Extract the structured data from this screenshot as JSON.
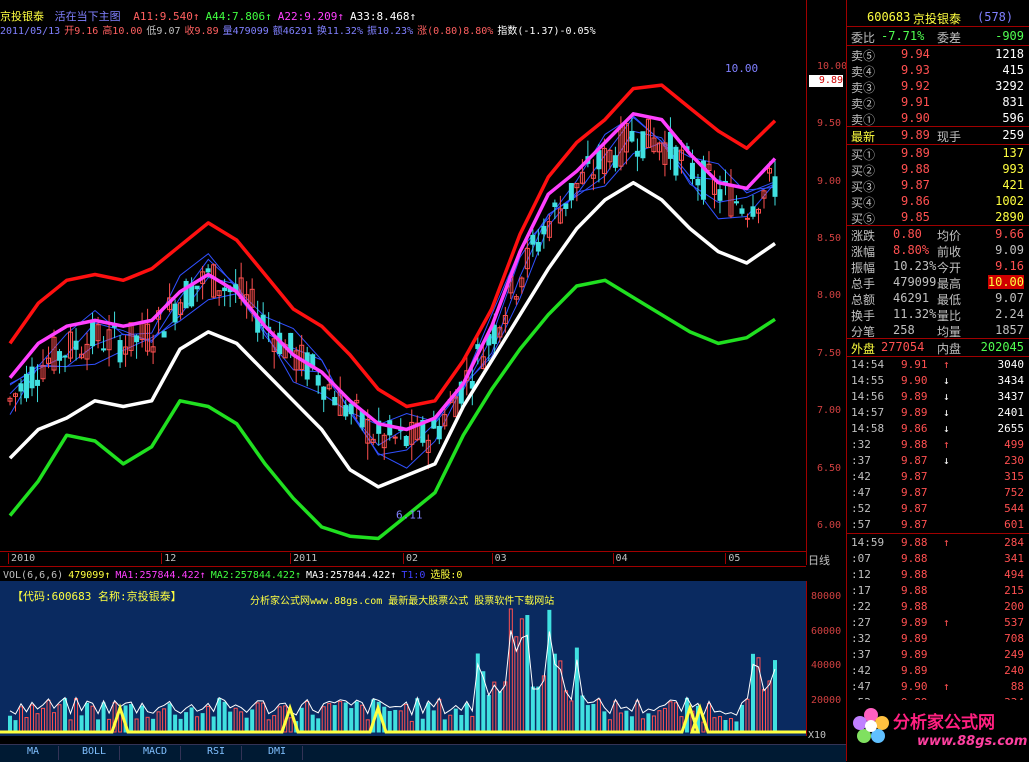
{
  "header": {
    "name": "京投银泰",
    "mode": "活在当下主图",
    "indicators": [
      {
        "text": "A11:9.540↑",
        "color": "#ff6060"
      },
      {
        "text": "A44:7.806↑",
        "color": "#40ff40"
      },
      {
        "text": "A22:9.209↑",
        "color": "#ff40ff"
      },
      {
        "text": "A33:8.468↑",
        "color": "#ffffff"
      }
    ],
    "info": [
      {
        "text": "2011/05/13",
        "color": "#8080ff"
      },
      {
        "text": "开9.16",
        "color": "#ff6060"
      },
      {
        "text": "高10.00",
        "color": "#ff6060"
      },
      {
        "text": "低9.07",
        "color": "#c0c0c0"
      },
      {
        "text": "收9.89",
        "color": "#ff6060"
      },
      {
        "text": "量479099",
        "color": "#8080ff"
      },
      {
        "text": "额46291",
        "color": "#8080ff"
      },
      {
        "text": "换11.32%",
        "color": "#8080ff"
      },
      {
        "text": "振10.23%",
        "color": "#8080ff"
      },
      {
        "text": "涨(0.80)8.80%",
        "color": "#ff6060"
      },
      {
        "text": "指数(-1.37)-0.05%",
        "color": "#ffffff"
      }
    ]
  },
  "price_axis": [
    "10.00",
    "9.50",
    "9.00",
    "8.50",
    "8.00",
    "7.50",
    "7.00",
    "6.50",
    "6.00"
  ],
  "current_price_tag": "9.89",
  "high_label": "10.00",
  "low_label": "6.11",
  "date_axis": [
    "2010",
    "12",
    "2011",
    "02",
    "03",
    "04",
    "05"
  ],
  "dayline_label": "日线",
  "volume": {
    "header": [
      {
        "text": "VOL(6,6,6)",
        "color": "#c0c0c0"
      },
      {
        "text": "479099↑",
        "color": "#ffff40"
      },
      {
        "text": "MA1:257844.422↑",
        "color": "#ff40ff"
      },
      {
        "text": "MA2:257844.422↑",
        "color": "#40ff40"
      },
      {
        "text": "MA3:257844.422↑",
        "color": "#ffffff"
      },
      {
        "text": "T1:0",
        "color": "#4040ff"
      },
      {
        "text": "选股:0",
        "color": "#ffff40"
      }
    ],
    "banner_code": "【代码:600683 名称:京投银泰】",
    "banner_site": "分析家公式网www.88gs.com 最新最大股票公式  股票软件下载网站",
    "axis": [
      "80000",
      "60000",
      "40000",
      "20000"
    ],
    "x10": "X10"
  },
  "tabs": [
    "MA",
    "BOLL",
    "MACD",
    "RSI",
    "DMI"
  ],
  "quote": {
    "code": "600683",
    "name": "京投银泰",
    "rank": "(578)",
    "weibi_label": "委比",
    "weibi": "-7.71%",
    "weicha_label": "委差",
    "weicha": "-909",
    "sells": [
      {
        "label": "卖⑤",
        "price": "9.94",
        "vol": "1218"
      },
      {
        "label": "卖④",
        "price": "9.93",
        "vol": "415"
      },
      {
        "label": "卖③",
        "price": "9.92",
        "vol": "3292"
      },
      {
        "label": "卖②",
        "price": "9.91",
        "vol": "831"
      },
      {
        "label": "卖①",
        "price": "9.90",
        "vol": "596"
      }
    ],
    "latest_label": "最新",
    "latest": "9.89",
    "xianshou_label": "现手",
    "xianshou": "259",
    "buys": [
      {
        "label": "买①",
        "price": "9.89",
        "vol": "137"
      },
      {
        "label": "买②",
        "price": "9.88",
        "vol": "993"
      },
      {
        "label": "买③",
        "price": "9.87",
        "vol": "421"
      },
      {
        "label": "买④",
        "price": "9.86",
        "vol": "1002"
      },
      {
        "label": "买⑤",
        "price": "9.85",
        "vol": "2890"
      }
    ],
    "stats": [
      {
        "l1": "涨跌",
        "v1": "0.80",
        "c1": "#ff5050",
        "l2": "均价",
        "v2": "9.66",
        "c2": "#ff5050"
      },
      {
        "l1": "涨幅",
        "v1": "8.80%",
        "c1": "#ff5050",
        "l2": "前收",
        "v2": "9.09",
        "c2": "#c0c0c0"
      },
      {
        "l1": "振幅",
        "v1": "10.23%",
        "c1": "#c0c0c0",
        "l2": "今开",
        "v2": "9.16",
        "c2": "#ff5050"
      },
      {
        "l1": "总手",
        "v1": "479099",
        "c1": "#c0c0c0",
        "l2": "最高",
        "v2": "10.00",
        "c2": "#ffff40"
      },
      {
        "l1": "总额",
        "v1": "46291",
        "c1": "#c0c0c0",
        "l2": "最低",
        "v2": "9.07",
        "c2": "#c0c0c0"
      },
      {
        "l1": "换手",
        "v1": "11.32%",
        "c1": "#c0c0c0",
        "l2": "量比",
        "v2": "2.24",
        "c2": "#c0c0c0"
      },
      {
        "l1": "分笔",
        "v1": "258",
        "c1": "#c0c0c0",
        "l2": "均量",
        "v2": "1857",
        "c2": "#c0c0c0"
      }
    ],
    "waipan_label": "外盘",
    "waipan": "277054",
    "neipan_label": "内盘",
    "neipan": "202045",
    "ticks": [
      {
        "t": "14:54",
        "p": "9.91",
        "a": "↑",
        "v": "3040"
      },
      {
        "t": "14:55",
        "p": "9.90",
        "a": "↓",
        "v": "3434"
      },
      {
        "t": "14:56",
        "p": "9.89",
        "a": "↓",
        "v": "3437"
      },
      {
        "t": "14:57",
        "p": "9.89",
        "a": "↓",
        "v": "2401"
      },
      {
        "t": "14:58",
        "p": "9.86",
        "a": "↓",
        "v": "2655"
      },
      {
        "t": ":32",
        "p": "9.88",
        "a": "↑",
        "v": "499"
      },
      {
        "t": ":37",
        "p": "9.87",
        "a": "↓",
        "v": "230"
      },
      {
        "t": ":42",
        "p": "9.87",
        "a": "",
        "v": "315"
      },
      {
        "t": ":47",
        "p": "9.87",
        "a": "",
        "v": "752"
      },
      {
        "t": ":52",
        "p": "9.87",
        "a": "",
        "v": "544"
      },
      {
        "t": ":57",
        "p": "9.87",
        "a": "",
        "v": "601"
      },
      {
        "t": "14:59",
        "p": "9.88",
        "a": "↑",
        "v": "284"
      },
      {
        "t": ":07",
        "p": "9.88",
        "a": "",
        "v": "341"
      },
      {
        "t": ":12",
        "p": "9.88",
        "a": "",
        "v": "494"
      },
      {
        "t": ":17",
        "p": "9.88",
        "a": "",
        "v": "215"
      },
      {
        "t": ":22",
        "p": "9.88",
        "a": "",
        "v": "200"
      },
      {
        "t": ":27",
        "p": "9.89",
        "a": "↑",
        "v": "537"
      },
      {
        "t": ":32",
        "p": "9.89",
        "a": "",
        "v": "708"
      },
      {
        "t": ":37",
        "p": "9.89",
        "a": "",
        "v": "249"
      },
      {
        "t": ":42",
        "p": "9.89",
        "a": "",
        "v": "240"
      },
      {
        "t": ":47",
        "p": "9.90",
        "a": "↑",
        "v": "88"
      },
      {
        "t": ":52",
        "p": "9.89",
        "a": "↓",
        "v": "334"
      }
    ],
    "logo_text": "分析家公式网",
    "logo_url": "www.88gs.com"
  },
  "colors": {
    "up": "#ff5050",
    "down": "#40e0e0",
    "band_red": "#ff1010",
    "band_magenta": "#ff40ff",
    "band_green": "#20e020",
    "band_white": "#ffffff",
    "band_blue": "#3050ff",
    "vol_bg": "#0a2a60"
  },
  "chart_data": {
    "type": "line",
    "price_range": [
      5.8,
      10.4
    ],
    "series": [
      {
        "name": "A11",
        "values": [
          7.6,
          7.95,
          8.15,
          8.2,
          8.15,
          8.25,
          8.45,
          8.65,
          8.5,
          8.2,
          7.9,
          7.75,
          7.5,
          7.2,
          7.05,
          7.1,
          7.45,
          7.9,
          8.55,
          9.05,
          9.35,
          9.55,
          9.82,
          9.85,
          9.65,
          9.45,
          9.3,
          9.54
        ]
      },
      {
        "name": "A22",
        "values": [
          7.3,
          7.6,
          7.75,
          7.8,
          7.75,
          7.8,
          8.05,
          8.2,
          8.05,
          7.75,
          7.5,
          7.35,
          7.1,
          6.9,
          6.85,
          6.95,
          7.25,
          7.75,
          8.4,
          8.9,
          9.1,
          9.35,
          9.6,
          9.55,
          9.25,
          9.0,
          8.95,
          9.21
        ]
      },
      {
        "name": "A33",
        "values": [
          6.6,
          6.85,
          6.95,
          7.1,
          7.05,
          7.1,
          7.55,
          7.7,
          7.6,
          7.35,
          7.1,
          6.85,
          6.5,
          6.35,
          6.45,
          6.55,
          7.05,
          7.45,
          7.85,
          8.25,
          8.6,
          8.85,
          9.0,
          8.85,
          8.6,
          8.4,
          8.3,
          8.47
        ]
      },
      {
        "name": "A44",
        "values": [
          6.1,
          6.4,
          6.8,
          6.75,
          6.55,
          6.7,
          7.1,
          7.05,
          6.9,
          6.55,
          6.25,
          6.0,
          5.92,
          5.9,
          6.1,
          6.3,
          6.8,
          7.2,
          7.55,
          7.85,
          8.1,
          8.15,
          8.0,
          7.85,
          7.7,
          7.6,
          7.65,
          7.81
        ]
      }
    ]
  }
}
